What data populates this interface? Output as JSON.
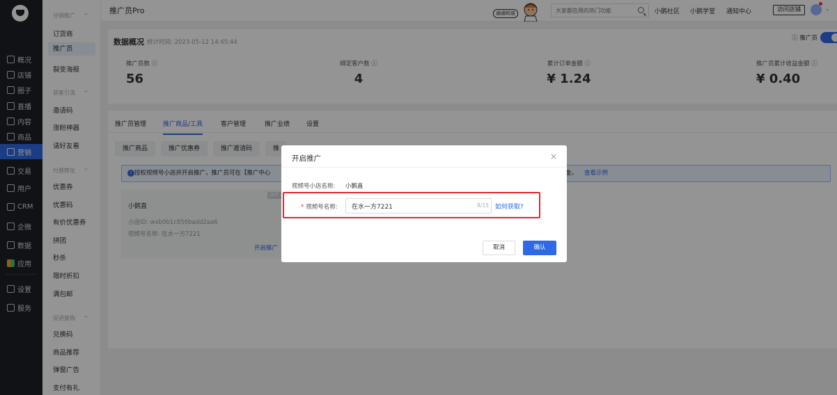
{
  "topbar": {
    "title": "推广员Pro",
    "banner_chip": "通通知道",
    "search_placeholder": "大家都在用的热门功能",
    "links": [
      "小鹅社区",
      "小鹅学堂",
      "通知中心"
    ],
    "visit_store": "访问店铺"
  },
  "nav": {
    "items": [
      "概况",
      "店铺",
      "圈子",
      "直播",
      "内容",
      "商品",
      "营销",
      "交易",
      "用户",
      "CRM",
      "企微",
      "数据",
      "应用",
      "设置",
      "服务"
    ],
    "active": "营销"
  },
  "submenu": {
    "groups": [
      {
        "title": "分销推广",
        "items": [
          "订货商",
          "推广员",
          "裂变海报"
        ]
      },
      {
        "title": "获客引流",
        "items": [
          "邀请码",
          "涨粉神器",
          "请好友看"
        ]
      },
      {
        "title": "付费转化",
        "items": [
          "优惠券",
          "优惠码",
          "有价优惠券",
          "拼团",
          "秒杀",
          "限时折扣",
          "满包邮"
        ]
      },
      {
        "title": "促进复购",
        "items": [
          "兑换码",
          "商品推荐",
          "弹窗广告",
          "支付有礼"
        ]
      }
    ],
    "active": "推广员"
  },
  "overview": {
    "title": "数据概况",
    "stat_time": "统计时间: 2023-05-12 14:45:44",
    "toggle_label": "推广员",
    "stats": [
      {
        "label": "推广员数",
        "value": "56"
      },
      {
        "label": "绑定客户数",
        "value": "4"
      },
      {
        "label": "累计订单金额",
        "value": "¥ 1.24"
      },
      {
        "label": "推广员累计收益金额",
        "value": "¥ 0.40"
      }
    ]
  },
  "tabs": [
    "推广员管理",
    "推广商品/工具",
    "客户管理",
    "推广业绩",
    "设置"
  ],
  "active_tab": "推广商品/工具",
  "subtabs": [
    "推广商品",
    "推广优惠券",
    "推广邀请码",
    "推"
  ],
  "info_bar": {
    "text": "授权视频号小店并开启推广，推广员可在【推广中心",
    "tail": "取佣金。",
    "link": "查看示例"
  },
  "shop_card": {
    "tag": "未开",
    "name": "小鹅直",
    "id": "小店ID:  wxb0b1c856badd2aa6",
    "video_name": "视频号名称:  在水一方7221",
    "button": "开启推广"
  },
  "modal": {
    "title": "开启推广",
    "close": "×",
    "shop_name_label": "视频号小店名称:",
    "shop_name_value": "小鹅直",
    "video_label": "视频号名称:",
    "video_value": "在水一方7221",
    "counter": "8/15",
    "how_link": "如何获取?",
    "cancel": "取消",
    "confirm": "确认"
  }
}
